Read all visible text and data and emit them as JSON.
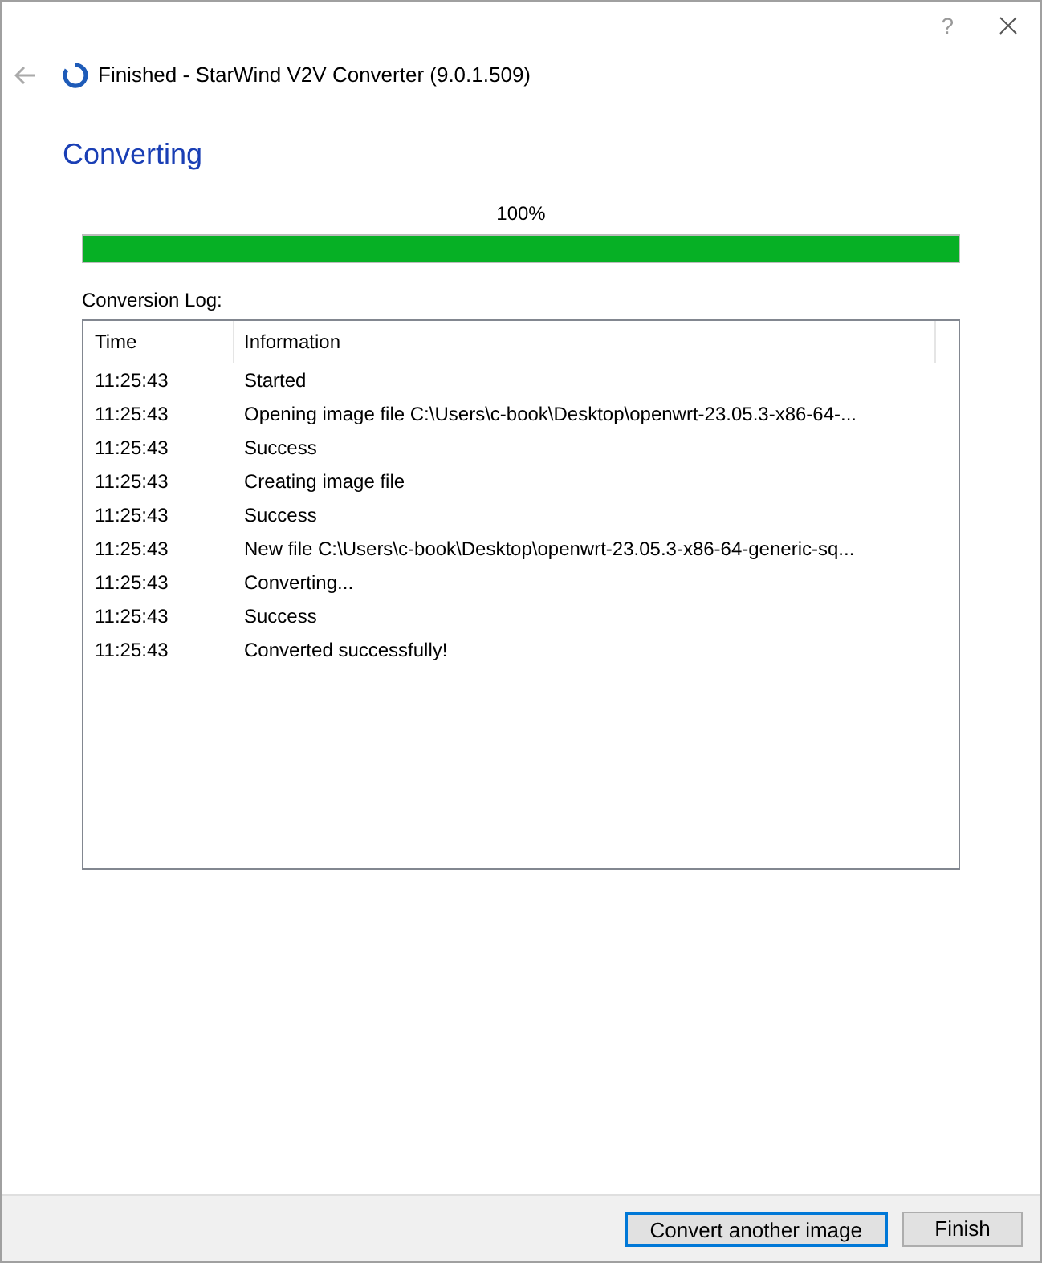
{
  "window": {
    "help": "?",
    "title": "Finished - StarWind V2V Converter (9.0.1.509)"
  },
  "heading": "Converting",
  "progress": {
    "reading": "100%",
    "level": 1
  },
  "log": {
    "label": "Conversion Log:",
    "columns": [
      "Time",
      "Information"
    ],
    "rows": [
      {
        "time": "11:25:43",
        "information": "Started"
      },
      {
        "time": "11:25:43",
        "information": "Opening image file C:\\Users\\c-book\\Desktop\\openwrt-23.05.3-x86-64-..."
      },
      {
        "time": "11:25:43",
        "information": "Success"
      },
      {
        "time": "11:25:43",
        "information": "Creating image file"
      },
      {
        "time": "11:25:43",
        "information": "Success"
      },
      {
        "time": "11:25:43",
        "information": "New file C:\\Users\\c-book\\Desktop\\openwrt-23.05.3-x86-64-generic-sq..."
      },
      {
        "time": "11:25:43",
        "information": "Converting..."
      },
      {
        "time": "11:25:43",
        "information": "Success"
      },
      {
        "time": "11:25:43",
        "information": "Converted successfully!"
      }
    ]
  },
  "buttons": [
    {
      "label": "Convert another image",
      "default": true
    },
    {
      "label": "Finish",
      "default": false
    }
  ]
}
